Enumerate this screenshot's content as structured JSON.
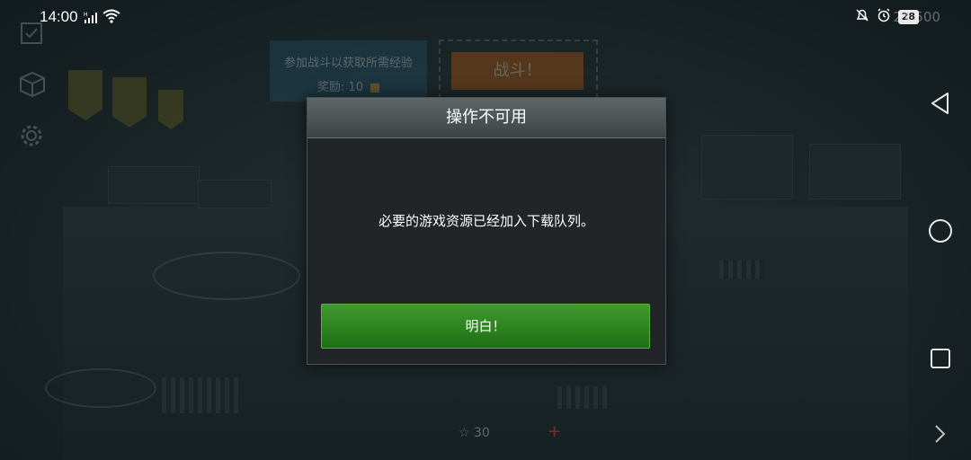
{
  "status_bar": {
    "time": "14:00",
    "signal_label": "H",
    "battery": "28",
    "credits": "21 500"
  },
  "game": {
    "quest_line1": "参加战斗以获取所需经验",
    "quest_reward_label": "奖励:",
    "quest_reward_value": "10",
    "battle_button": "战斗！",
    "stars_count": "30"
  },
  "dialog": {
    "title": "操作不可用",
    "message": "必要的游戏资源已经加入下载队列。",
    "confirm_button": "明白！"
  },
  "colors": {
    "dialog_button": "#2f8a22",
    "dialog_header": "#4e5557",
    "dialog_body": "#222527"
  }
}
